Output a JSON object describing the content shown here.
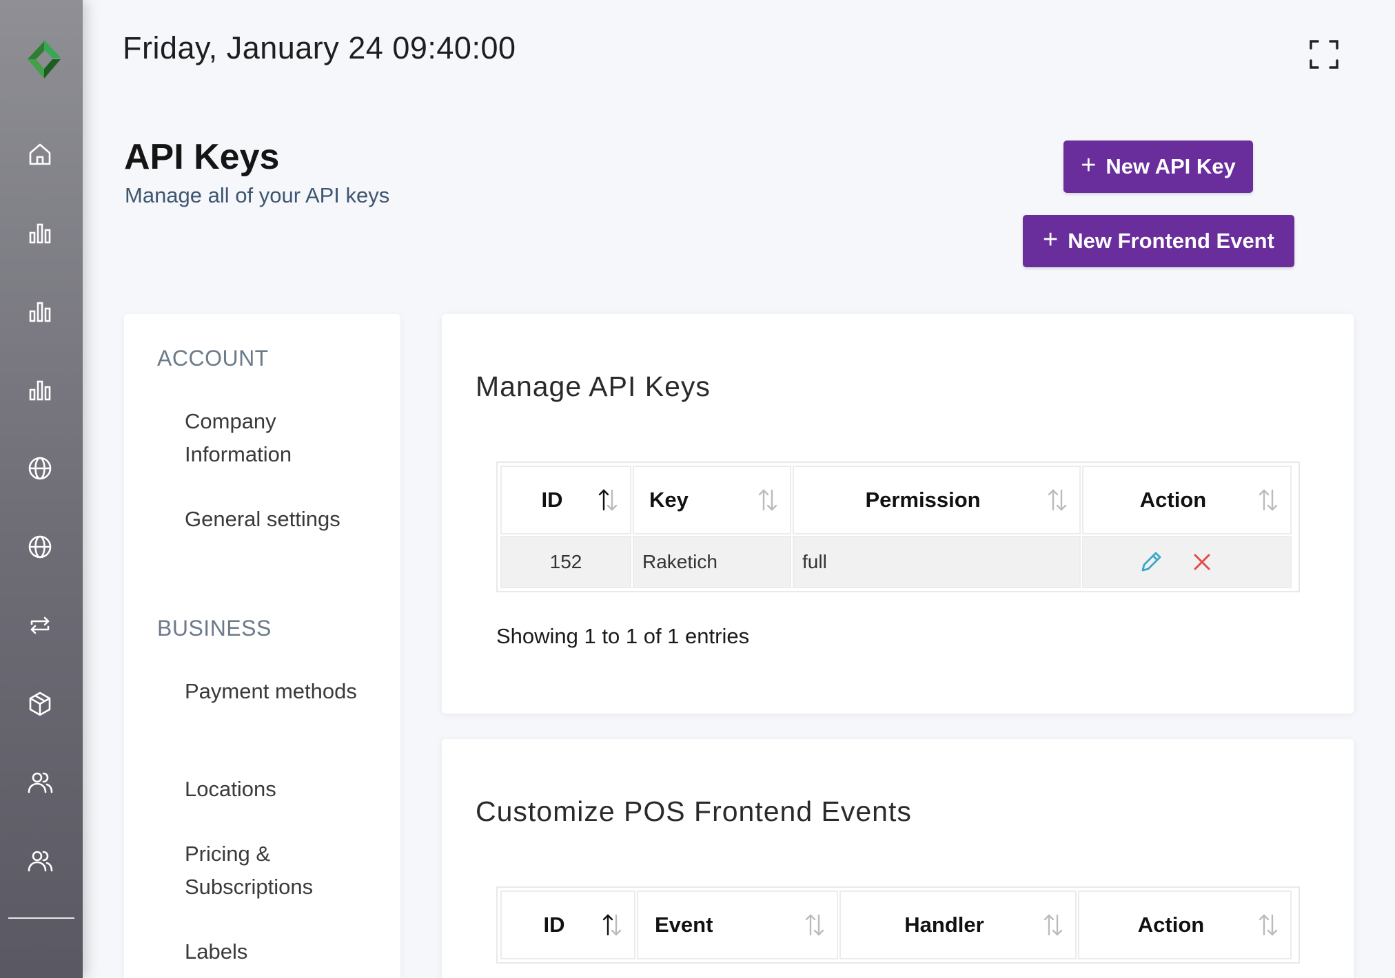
{
  "header": {
    "datetime": "Friday, January 24 09:40:00",
    "fullscreen_icon": "fullscreen-icon"
  },
  "rail": {
    "logo": "brand-logo-icon",
    "items": [
      {
        "icon": "home-icon"
      },
      {
        "icon": "bar-chart-icon"
      },
      {
        "icon": "bar-chart-icon"
      },
      {
        "icon": "bar-chart-icon"
      },
      {
        "icon": "globe-icon"
      },
      {
        "icon": "globe-icon"
      },
      {
        "icon": "repeat-icon"
      },
      {
        "icon": "package-icon"
      },
      {
        "icon": "users-icon"
      },
      {
        "icon": "users-icon"
      }
    ]
  },
  "page": {
    "title": "API Keys",
    "subtitle": "Manage all of your API keys"
  },
  "actions": {
    "new_api_key": "New API Key",
    "new_frontend_event": "New Frontend Event"
  },
  "settings_menu": {
    "account_heading": "ACCOUNT",
    "business_heading": "BUSINESS",
    "account_items": [
      "Company Information",
      "General settings"
    ],
    "business_items": [
      "Payment methods",
      "Locations",
      "Pricing & Subscriptions",
      "Labels"
    ]
  },
  "api_keys": {
    "title": "Manage API Keys",
    "columns": [
      "ID",
      "Key",
      "Permission",
      "Action"
    ],
    "rows": [
      {
        "id": "152",
        "key": "Raketich",
        "permission": "full"
      }
    ],
    "footer": "Showing 1 to 1 of 1 entries"
  },
  "frontend_events": {
    "title": "Customize POS Frontend Events",
    "columns": [
      "ID",
      "Event",
      "Handler",
      "Action"
    ]
  },
  "colors": {
    "accent": "#6a2d9c",
    "edit": "#3aa7c9",
    "delete": "#e5484d"
  }
}
